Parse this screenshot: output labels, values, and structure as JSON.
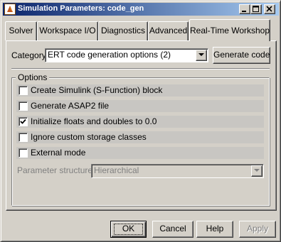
{
  "window": {
    "title": "Simulation Parameters: code_gen",
    "controls": [
      "minimize",
      "maximize",
      "close"
    ]
  },
  "tabs": [
    {
      "label": "Solver",
      "active": false
    },
    {
      "label": "Workspace I/O",
      "active": false
    },
    {
      "label": "Diagnostics",
      "active": false
    },
    {
      "label": "Advanced",
      "active": false
    },
    {
      "label": "Real-Time Workshop",
      "active": true
    }
  ],
  "category": {
    "label": "Category:",
    "value": "ERT code generation options (2)",
    "generate_button": "Generate code"
  },
  "options": {
    "group_label": "Options",
    "items": [
      {
        "label": "Create Simulink (S-Function) block",
        "checked": false
      },
      {
        "label": "Generate ASAP2 file",
        "checked": false
      },
      {
        "label": "Initialize floats and doubles to 0.0",
        "checked": true
      },
      {
        "label": "Ignore custom storage classes",
        "checked": false
      },
      {
        "label": "External mode",
        "checked": false
      }
    ],
    "parameter_structure": {
      "label": "Parameter structure:",
      "value": "Hierarchical",
      "enabled": false
    }
  },
  "buttons": {
    "ok": "OK",
    "cancel": "Cancel",
    "help": "Help",
    "apply": "Apply"
  }
}
